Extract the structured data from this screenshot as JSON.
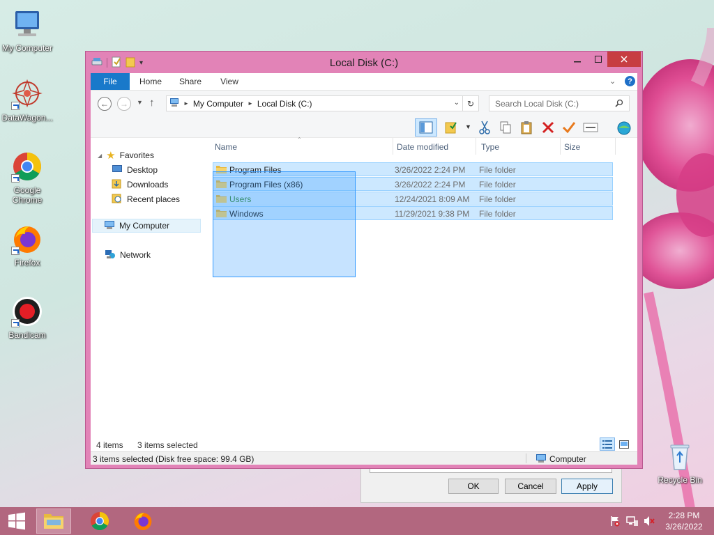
{
  "desktop": {
    "icons": [
      {
        "label": "My Computer",
        "icon": "computer-icon"
      },
      {
        "label": "DataWagon...",
        "icon": "datawagon-icon"
      },
      {
        "label": "Google Chrome",
        "icon": "chrome-icon"
      },
      {
        "label": "Firefox",
        "icon": "firefox-icon"
      },
      {
        "label": "Bandicam",
        "icon": "bandicam-icon"
      },
      {
        "label": "Recycle Bin",
        "icon": "recycle-bin-icon"
      }
    ]
  },
  "window": {
    "title": "Local Disk (C:)",
    "ribbon_tabs": [
      "File",
      "Home",
      "Share",
      "View"
    ],
    "address": {
      "segments": [
        "My Computer",
        "Local Disk (C:)"
      ]
    },
    "search_placeholder": "Search Local Disk (C:)",
    "nav": {
      "favorites": "Favorites",
      "favorites_items": [
        "Desktop",
        "Downloads",
        "Recent places"
      ],
      "computer": "My Computer",
      "network": "Network"
    },
    "columns": [
      "Name",
      "Date modified",
      "Type",
      "Size"
    ],
    "files": [
      {
        "name": "Program Files",
        "date": "3/26/2022 2:24 PM",
        "type": "File folder",
        "selected": true
      },
      {
        "name": "Program Files (x86)",
        "date": "3/26/2022 2:24 PM",
        "type": "File folder",
        "selected": true
      },
      {
        "name": "Users",
        "date": "12/24/2021 8:09 AM",
        "type": "File folder",
        "selected": true
      },
      {
        "name": "Windows",
        "date": "11/29/2021 9:38 PM",
        "type": "File folder",
        "selected": true
      }
    ],
    "status": {
      "item_count": "4 items",
      "selected_count": "3 items selected",
      "details": "3 items selected (Disk free space: 99.4 GB)",
      "location": "Computer"
    }
  },
  "background_dialog": {
    "ok": "OK",
    "cancel": "Cancel",
    "apply": "Apply"
  },
  "taskbar": {
    "time": "2:28 PM",
    "date": "3/26/2022"
  },
  "colors": {
    "window_frame": "#e283b7",
    "selection": "#cce8ff",
    "selection_border": "#99d1ff",
    "file_tab": "#1979ca",
    "taskbar": "#b2677f"
  }
}
